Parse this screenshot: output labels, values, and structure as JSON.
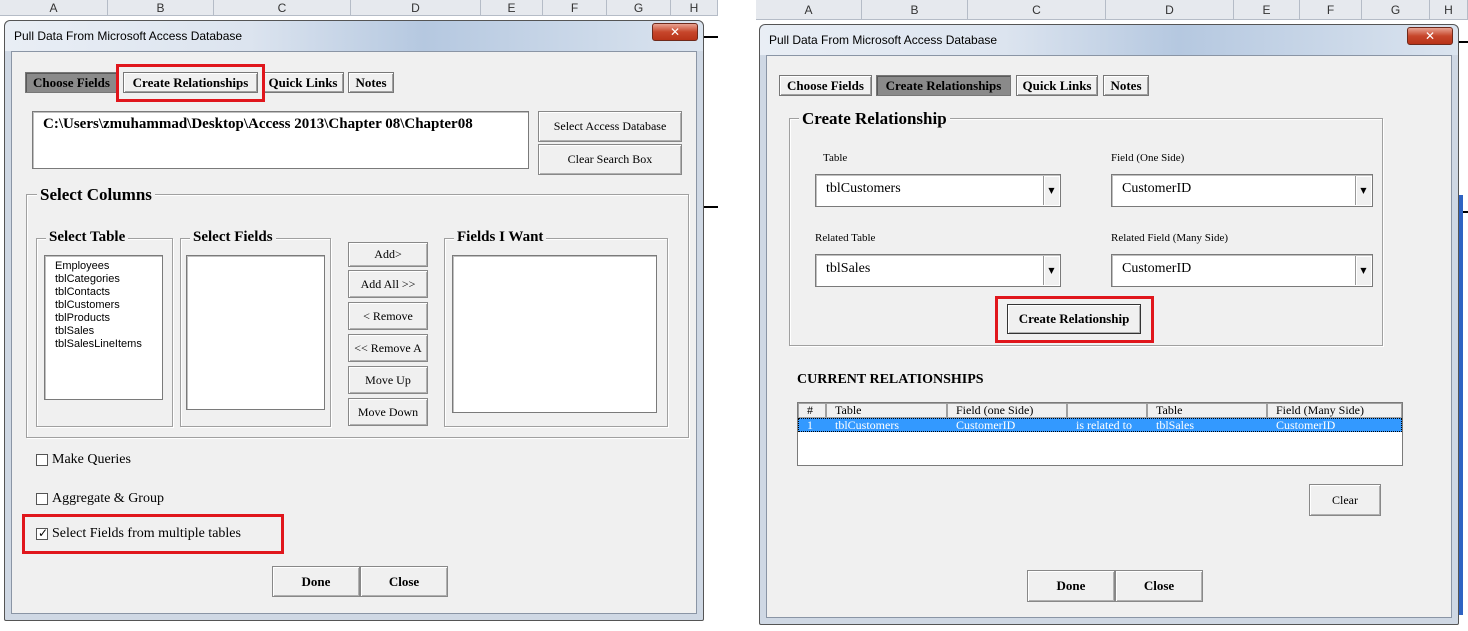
{
  "excel": {
    "left_columns": [
      "A",
      "B",
      "C",
      "D",
      "E",
      "F",
      "G",
      "H"
    ],
    "right_columns": [
      "A",
      "B",
      "C",
      "D",
      "E",
      "F",
      "G",
      "H"
    ]
  },
  "left_window": {
    "title": "Pull Data From Microsoft Access Database",
    "close_glyph": "✕",
    "tabs": [
      "Choose Fields",
      "Create Relationships",
      "Quick Links",
      "Notes"
    ],
    "path_text": "C:\\Users\\zmuhammad\\Desktop\\Access 2013\\Chapter 08\\Chapter08",
    "select_db_button": "Select Access Database",
    "clear_search_button": "Clear Search Box",
    "select_columns_caption": "Select  Columns",
    "select_table_caption": "Select Table",
    "tables": [
      "Employees",
      "tblCategories",
      "tblContacts",
      "tblCustomers",
      "tblProducts",
      "tblSales",
      "tblSalesLineItems"
    ],
    "select_fields_caption": "Select Fields",
    "fields_i_want_caption": "Fields I Want",
    "buttons": {
      "add": "Add>",
      "add_all": "Add All >>",
      "remove": "< Remove",
      "remove_all": "<< Remove A",
      "move_up": "Move Up",
      "move_down": "Move Down"
    },
    "checkboxes": {
      "make_queries": "Make Queries",
      "aggregate": "Aggregate & Group",
      "multi_tables": "Select Fields from multiple tables"
    },
    "check_glyph": "✓",
    "done": "Done",
    "close": "Close"
  },
  "right_window": {
    "title": "Pull Data From Microsoft Access Database",
    "close_glyph": "✕",
    "tabs": [
      "Choose Fields",
      "Create Relationships",
      "Quick Links",
      "Notes"
    ],
    "create_relationship_caption": "Create Relationship",
    "table_label": "Table",
    "table_value": "tblCustomers",
    "field_one_label": "Field (One Side)",
    "field_one_value": "CustomerID",
    "related_table_label": "Related Table",
    "related_table_value": "tblSales",
    "related_field_label": "Related Field (Many Side)",
    "related_field_value": "CustomerID",
    "combo_arrow_glyph": "▼",
    "create_button": "Create Relationship",
    "current_relationships_label": "CURRENT RELATIONSHIPS",
    "grid_headers": [
      "#",
      "Table",
      "Field (one Side)",
      "",
      "Table",
      "Field (Many Side)"
    ],
    "grid_rows": [
      [
        "1",
        "tblCustomers",
        "CustomerID",
        "is related to",
        "tblSales",
        "CustomerID"
      ]
    ],
    "clear": "Clear",
    "done": "Done",
    "close": "Close"
  },
  "colors": {
    "highlight_red": "#e0161c",
    "selection_blue": "#3399ff",
    "dialog_face": "#f0f0f0"
  }
}
